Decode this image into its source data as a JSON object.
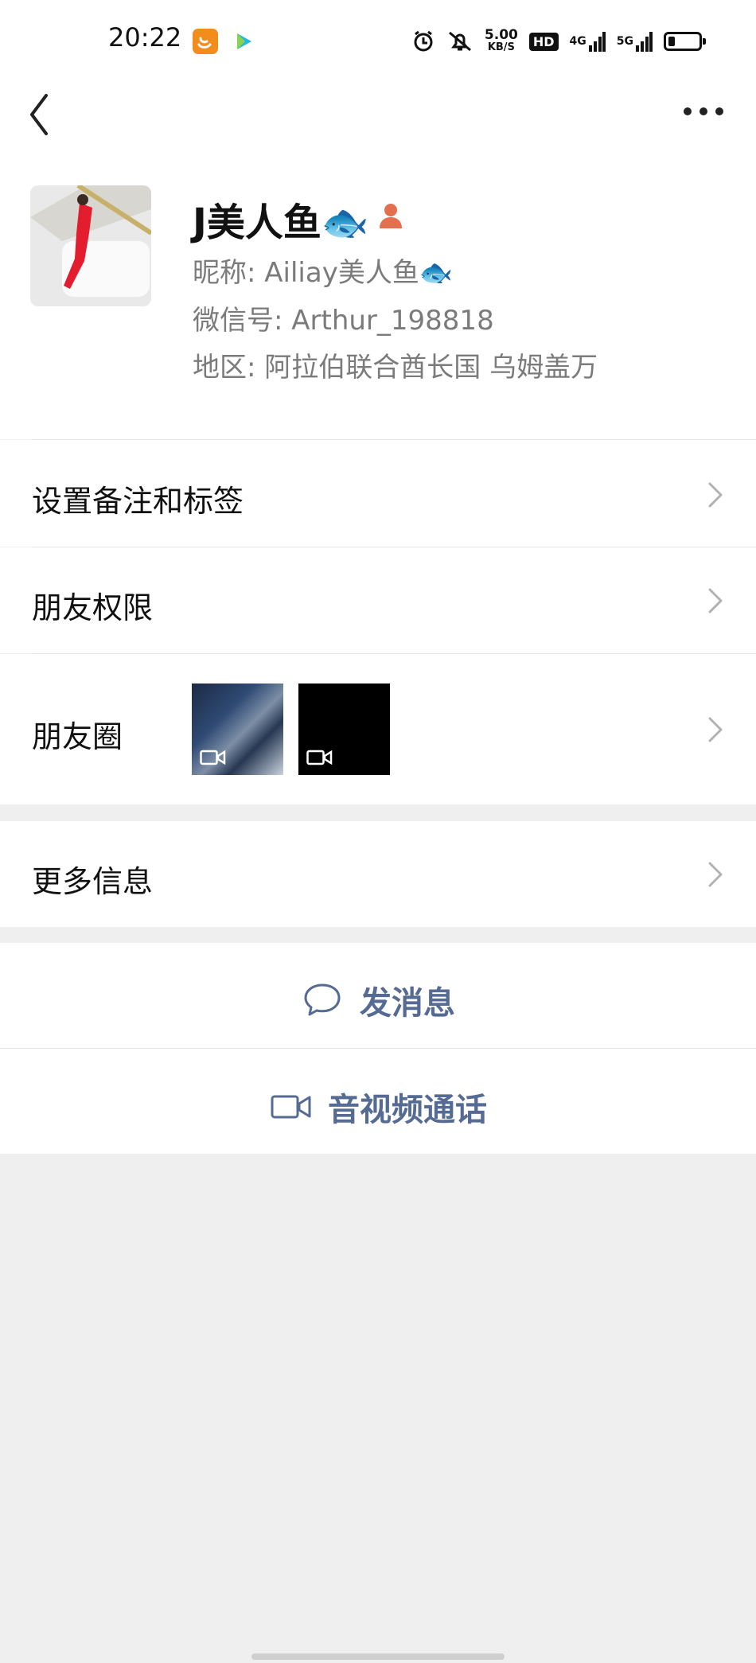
{
  "status_bar": {
    "time": "20:22",
    "net_speed_value": "5.00",
    "net_speed_unit": "KB/S",
    "hd_label": "HD",
    "net_4g": "4G",
    "net_5g": "5G",
    "icons": [
      "alarm-icon",
      "mute-bell-icon",
      "signal-icon",
      "signal-icon",
      "battery-icon"
    ]
  },
  "nav": {
    "back_icon": "chevron-left-icon",
    "more_icon": "more-dots-icon"
  },
  "profile": {
    "display_name": "J美人鱼🐟",
    "nickname": "昵称: Ailiay美人鱼🐟",
    "wechat_id": "微信号: Arthur_198818",
    "region": "地区: 阿拉伯联合酋长国 乌姆盖万"
  },
  "cells": {
    "remark_tags": "设置备注和标签",
    "permissions": "朋友权限",
    "moments": "朋友圈",
    "more_info": "更多信息"
  },
  "actions": {
    "send_message": "发消息",
    "video_call": "音视频通话"
  },
  "colors": {
    "action_text": "#566b94",
    "background": "#efefef",
    "card": "#ffffff"
  }
}
